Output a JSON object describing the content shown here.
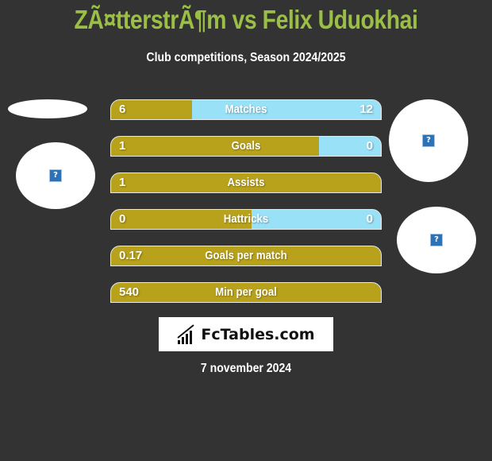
{
  "header": {
    "title": "ZÃ¤tterstrÃ¶m vs Felix Uduokhai",
    "subtitle": "Club competitions, Season 2024/2025"
  },
  "players": {
    "left": {
      "name": "ZÃ¤tterstrÃ¶m",
      "logo_icon": "broken-image-icon",
      "photo_icon": "broken-image-icon"
    },
    "right": {
      "name": "Felix Uduokhai",
      "photo_icon": "broken-image-icon",
      "logo_icon": "broken-image-icon"
    }
  },
  "colors": {
    "left_bar": "#b9a21b",
    "right_bar": "#99e1f7",
    "title": "#9bbf45",
    "background": "#333333"
  },
  "stats": [
    {
      "label": "Matches",
      "left": "6",
      "right": "12",
      "left_share": 0.3
    },
    {
      "label": "Goals",
      "left": "1",
      "right": "0",
      "left_share": 0.77
    },
    {
      "label": "Assists",
      "left": "1",
      "right": "",
      "left_share": 1.0
    },
    {
      "label": "Hattricks",
      "left": "0",
      "right": "0",
      "left_share": 0.52
    },
    {
      "label": "Goals per match",
      "left": "0.17",
      "right": "",
      "left_share": 1.0
    },
    {
      "label": "Min per goal",
      "left": "540",
      "right": "",
      "left_share": 1.0
    }
  ],
  "footer": {
    "brand": "FcTables.com",
    "date": "7 november 2024"
  }
}
